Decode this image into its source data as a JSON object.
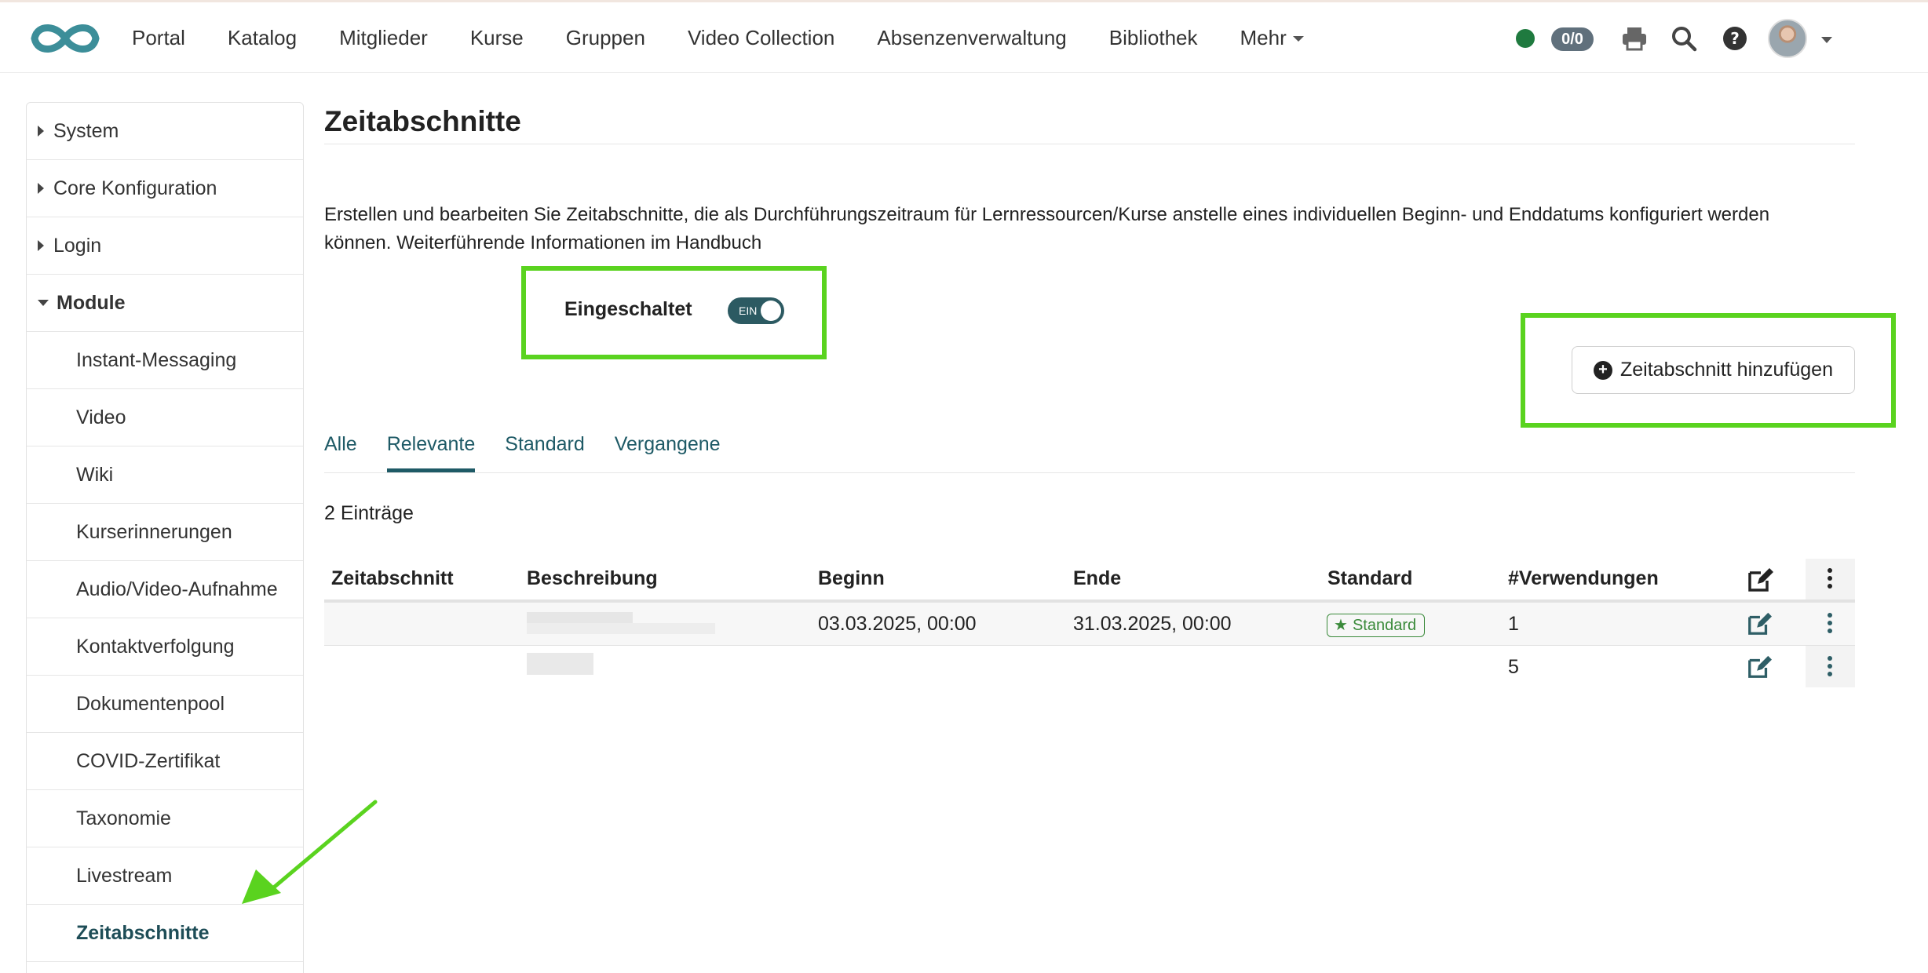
{
  "nav": {
    "items": [
      "Portal",
      "Katalog",
      "Mitglieder",
      "Kurse",
      "Gruppen",
      "Video Collection",
      "Absenzenverwaltung",
      "Bibliothek",
      "Mehr"
    ],
    "count_badge": "0/0",
    "icons": [
      "logo-infinity-icon",
      "status-dot",
      "print-icon",
      "search-icon",
      "help-icon",
      "avatar"
    ]
  },
  "sidebar": {
    "items": [
      {
        "label": "System",
        "level": "top",
        "state": "collapsed"
      },
      {
        "label": "Core Konfiguration",
        "level": "top",
        "state": "collapsed"
      },
      {
        "label": "Login",
        "level": "top",
        "state": "collapsed"
      },
      {
        "label": "Module",
        "level": "top",
        "state": "expanded"
      },
      {
        "label": "Instant-Messaging",
        "level": "sub"
      },
      {
        "label": "Video",
        "level": "sub"
      },
      {
        "label": "Wiki",
        "level": "sub"
      },
      {
        "label": "Kurserinnerungen",
        "level": "sub"
      },
      {
        "label": "Audio/Video-Aufnahme",
        "level": "sub"
      },
      {
        "label": "Kontaktverfolgung",
        "level": "sub"
      },
      {
        "label": "Dokumentenpool",
        "level": "sub"
      },
      {
        "label": "COVID-Zertifikat",
        "level": "sub"
      },
      {
        "label": "Taxonomie",
        "level": "sub"
      },
      {
        "label": "Livestream",
        "level": "sub"
      },
      {
        "label": "Zeitabschnitte",
        "level": "sub",
        "state": "active"
      }
    ]
  },
  "main": {
    "title": "Zeitabschnitte",
    "description_line1": "Erstellen und bearbeiten Sie Zeitabschnitte, die als Durchführungszeitraum für Lernressourcen/Kurse anstelle eines individuellen Beginn- und Enddatums konfiguriert werden",
    "description_line2": "können. Weiterführende Informationen im Handbuch",
    "toggle": {
      "label": "Eingeschaltet",
      "state_text": "EIN",
      "on": true
    },
    "add_button": "Zeitabschnitt hinzufügen",
    "tabs": [
      "Alle",
      "Relevante",
      "Standard",
      "Vergangene"
    ],
    "active_tab": "Relevante",
    "entries_count": "2 Einträge",
    "table": {
      "headers": [
        "Zeitabschnitt",
        "Beschreibung",
        "Beginn",
        "Ende",
        "Standard",
        "#Verwendungen"
      ],
      "rows": [
        {
          "zeitabschnitt": "",
          "beschreibung": "[blurred]",
          "beginn": "03.03.2025, 00:00",
          "ende": "31.03.2025, 00:00",
          "standard": "Standard",
          "verwendungen": "1"
        },
        {
          "zeitabschnitt": "",
          "beschreibung": "[blurred]",
          "beginn": "",
          "ende": "",
          "standard": "",
          "verwendungen": "5"
        }
      ]
    }
  },
  "colors": {
    "accent": "#1e5a66",
    "highlight": "#5ad31f",
    "status_green": "#1f7a3f",
    "badge_green": "#3a8a3a"
  }
}
